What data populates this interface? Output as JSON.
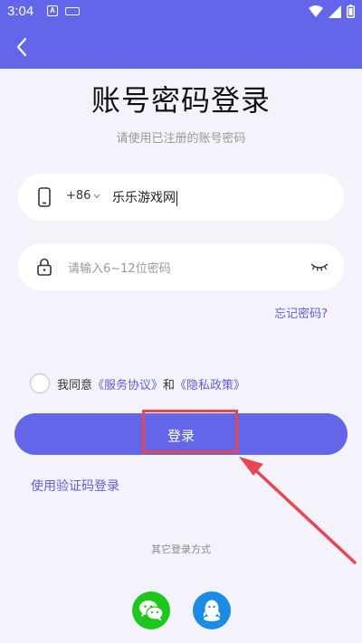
{
  "status_bar": {
    "time": "3:04",
    "notif_a": "A"
  },
  "header": {
    "back_icon": "chevron-left-icon"
  },
  "title": "账号密码登录",
  "subtitle": "请使用已注册的账号密码",
  "phone": {
    "country_code": "+86",
    "value": "乐乐游戏网",
    "icon": "phone-icon"
  },
  "password": {
    "placeholder": "请输入6~12位密码",
    "icon": "lock-icon",
    "toggle_icon": "eye-closed-icon"
  },
  "forgot_label": "忘记密码?",
  "agreement": {
    "prefix": "我同意",
    "service_link": "《服务协议》",
    "and": "和",
    "privacy_link": "《隐私政策》"
  },
  "login_button": "登录",
  "sms_login": "使用验证码登录",
  "other_login_label": "其它登录方式",
  "social": [
    {
      "name": "wechat-icon"
    },
    {
      "name": "qq-icon"
    }
  ],
  "colors": {
    "primary": "#6366e8",
    "link": "#5b5fe0",
    "highlight": "#e94650",
    "wechat": "#1dc71d",
    "qq": "#1a8ce6"
  }
}
